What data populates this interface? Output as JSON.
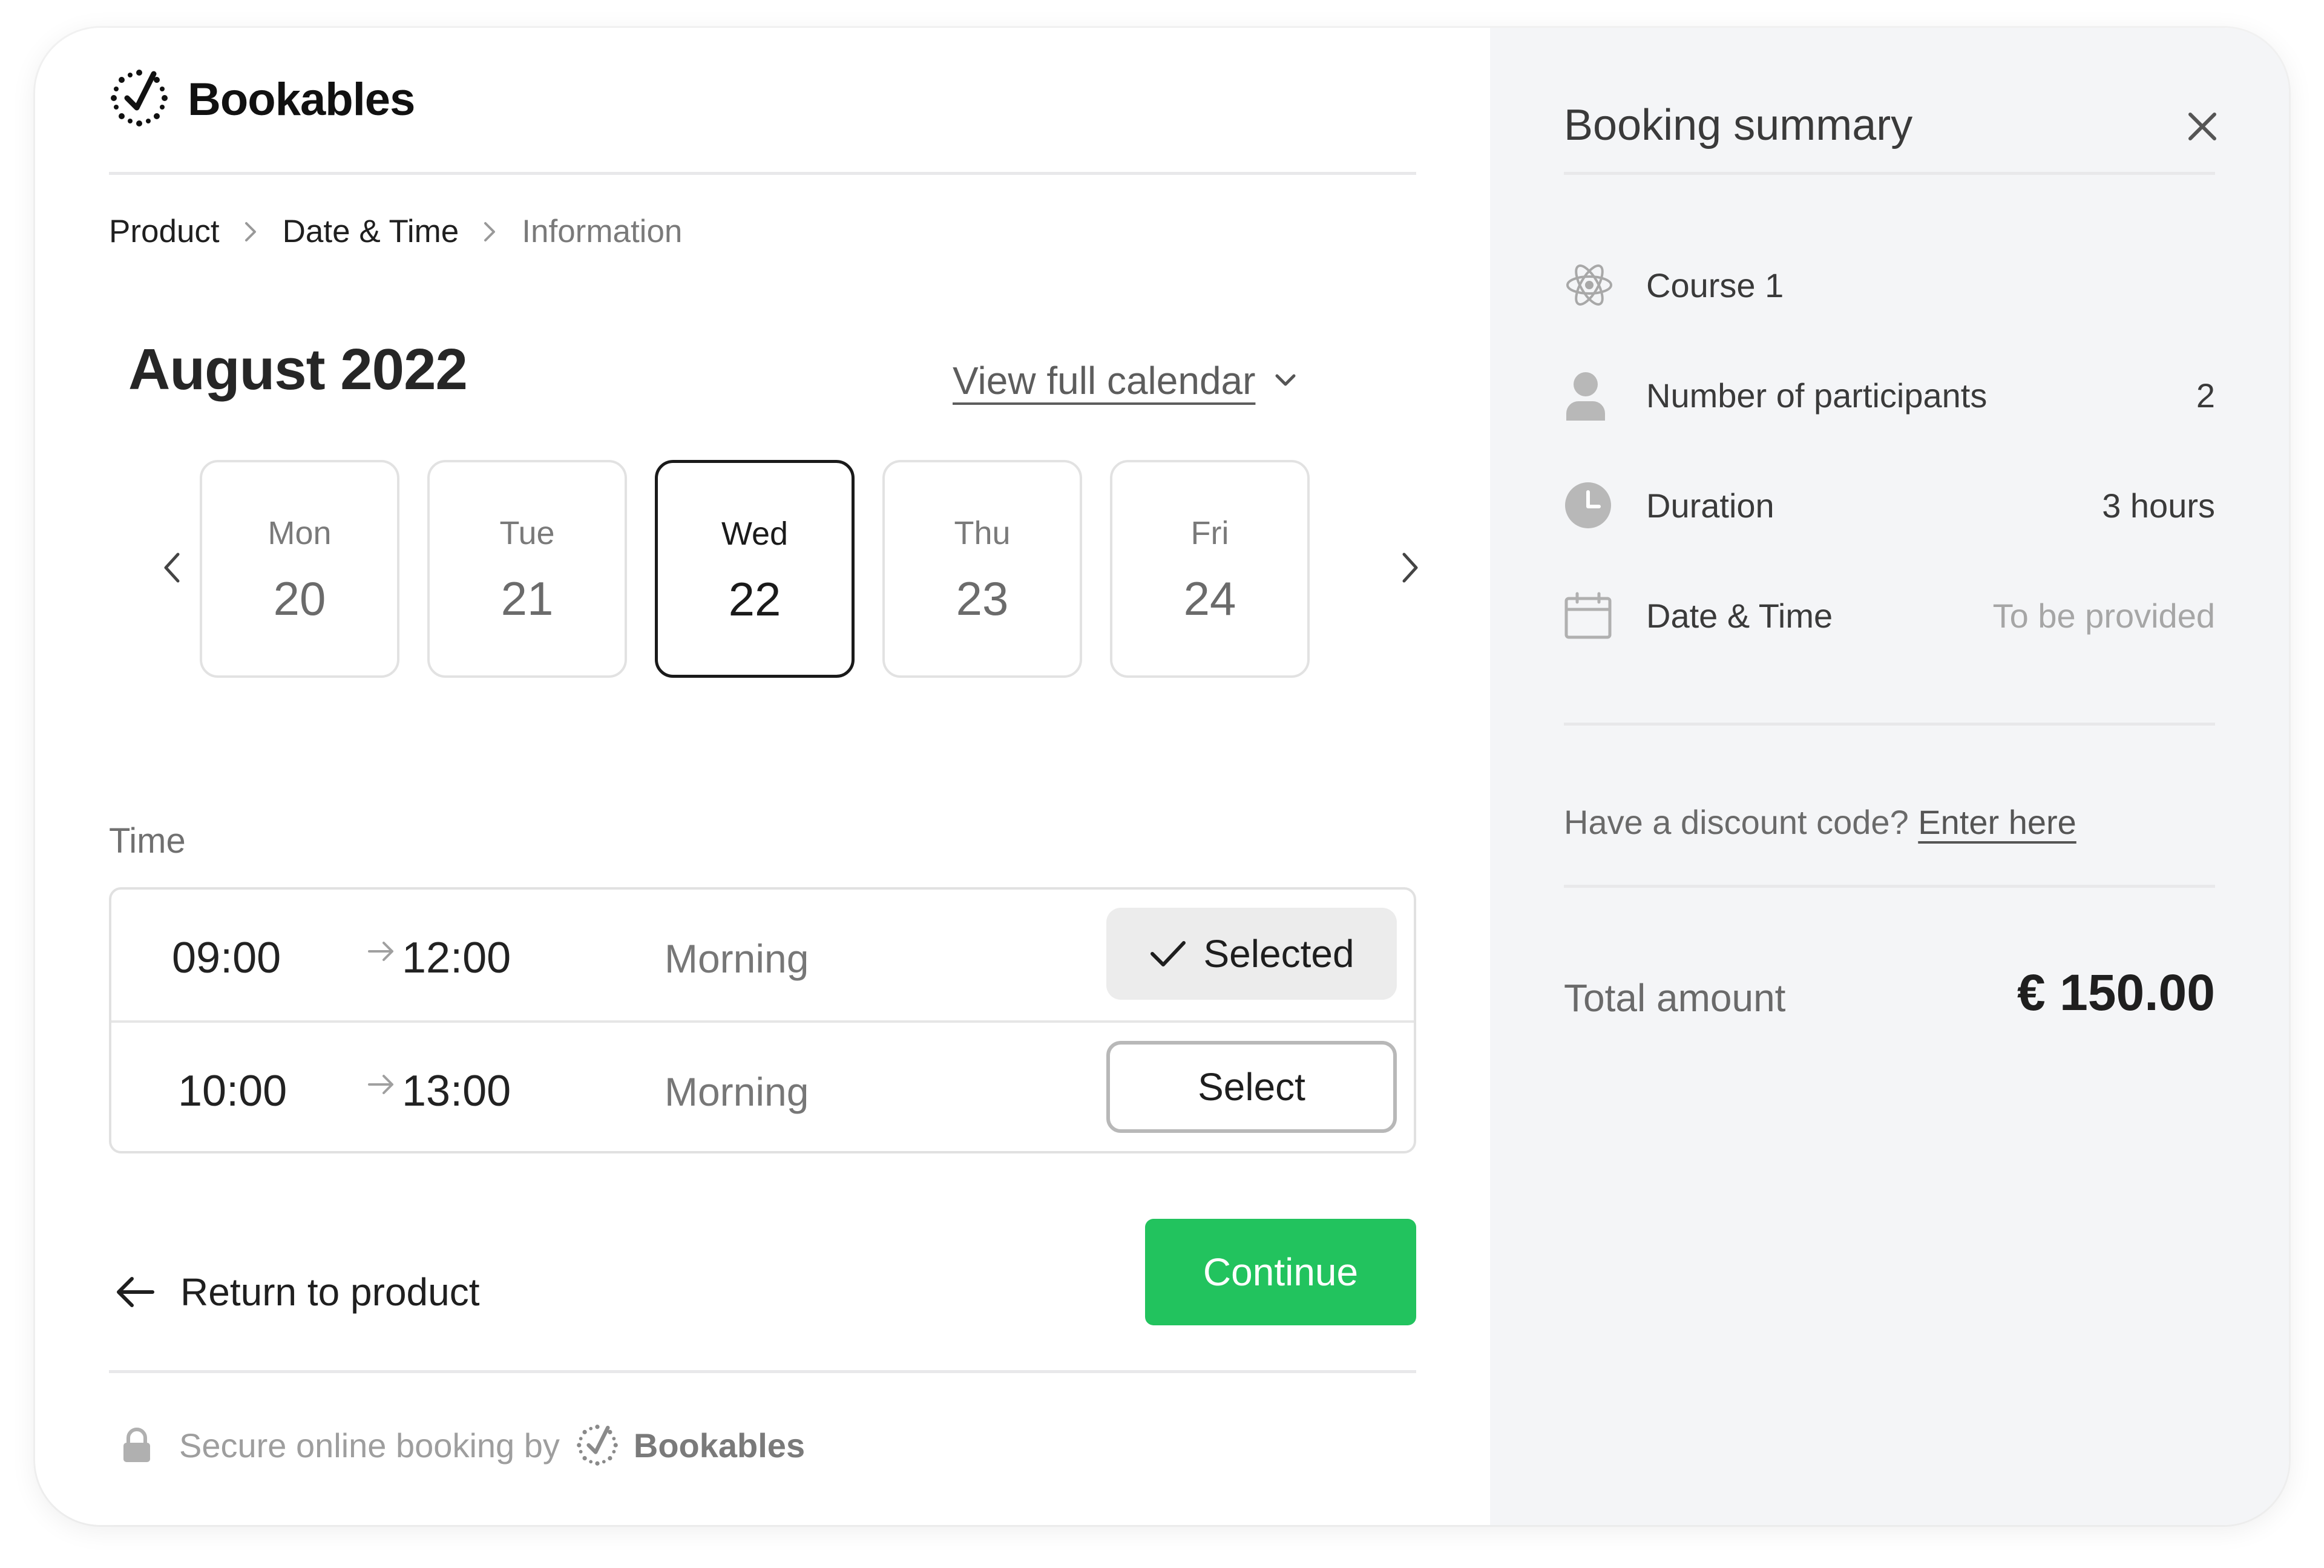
{
  "app": {
    "brand": "Bookables"
  },
  "breadcrumb": [
    "Product",
    "Date & Time",
    "Information"
  ],
  "calendar": {
    "month_label": "August 2022",
    "view_full_calendar": "View full calendar",
    "days": [
      {
        "weekday": "Mon",
        "day": "20",
        "selected": false
      },
      {
        "weekday": "Tue",
        "day": "21",
        "selected": false
      },
      {
        "weekday": "Wed",
        "day": "22",
        "selected": true
      },
      {
        "weekday": "Thu",
        "day": "23",
        "selected": false
      },
      {
        "weekday": "Fri",
        "day": "24",
        "selected": false
      }
    ]
  },
  "time": {
    "label": "Time",
    "slots": [
      {
        "start": "09:00",
        "end": "12:00",
        "period": "Morning",
        "button": "Selected",
        "selected": true
      },
      {
        "start": "10:00",
        "end": "13:00",
        "period": "Morning",
        "button": "Select",
        "selected": false
      }
    ]
  },
  "actions": {
    "return_label": "Return to product",
    "continue_label": "Continue"
  },
  "footer": {
    "text": "Secure online booking by",
    "brand": "Bookables"
  },
  "summary": {
    "title": "Booking summary",
    "rows": [
      {
        "icon": "course-icon",
        "label": "Course 1",
        "value": ""
      },
      {
        "icon": "user-icon",
        "label": "Number of participants",
        "value": "2"
      },
      {
        "icon": "clock-icon",
        "label": "Duration",
        "value": "3 hours"
      },
      {
        "icon": "calendar-icon",
        "label": "Date & Time",
        "value": "To be provided"
      }
    ],
    "discount_prompt": "Have a discount code?",
    "discount_link": "Enter here",
    "total_label": "Total amount",
    "total_value": "€ 150.00"
  },
  "colors": {
    "accent": "#22c35e",
    "sidebar_bg": "#f4f5f7"
  }
}
